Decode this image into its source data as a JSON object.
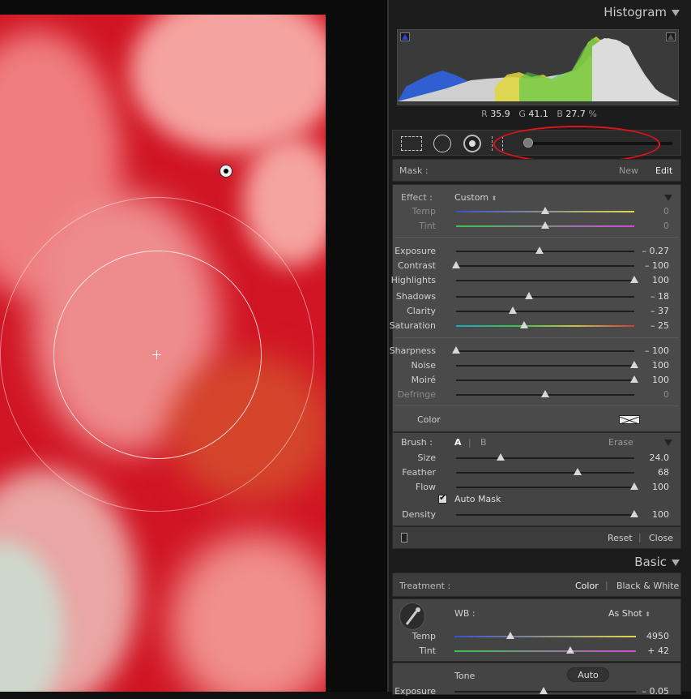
{
  "histogram": {
    "title": "Histogram",
    "readout": {
      "r_label": "R",
      "r_value": "35.9",
      "g_label": "G",
      "g_value": "41.1",
      "b_label": "B",
      "b_value": "27.7",
      "unit": "%"
    }
  },
  "toolstrip": {
    "icons": [
      "crop-overlay-icon",
      "spot-removal-icon",
      "red-eye-icon",
      "graduated-filter-icon"
    ],
    "highlight_color": "#e3121b"
  },
  "mask": {
    "label": "Mask :",
    "new_label": "New",
    "edit_label": "Edit"
  },
  "effect": {
    "label": "Effect :",
    "preset": "Custom",
    "groups": [
      [
        {
          "label": "Temp",
          "value": "0",
          "pos": 0.5,
          "track": "temp",
          "dim": true
        },
        {
          "label": "Tint",
          "value": "0",
          "pos": 0.5,
          "track": "tint",
          "dim": true
        }
      ],
      [
        {
          "label": "Exposure",
          "value": "– 0.27",
          "pos": 0.47
        },
        {
          "label": "Contrast",
          "value": "– 100",
          "pos": 0.0
        },
        {
          "label": "Highlights",
          "value": "100",
          "pos": 1.0
        },
        {
          "label": "Shadows",
          "value": "– 18",
          "pos": 0.41
        },
        {
          "label": "Clarity",
          "value": "– 37",
          "pos": 0.32
        },
        {
          "label": "Saturation",
          "value": "– 25",
          "pos": 0.38,
          "track": "sat"
        }
      ],
      [
        {
          "label": "Sharpness",
          "value": "– 100",
          "pos": 0.0
        },
        {
          "label": "Noise",
          "value": "100",
          "pos": 1.0
        },
        {
          "label": "Moiré",
          "value": "100",
          "pos": 1.0
        },
        {
          "label": "Defringe",
          "value": "0",
          "pos": 0.5,
          "dim": true
        }
      ]
    ],
    "color_label": "Color"
  },
  "brush": {
    "label": "Brush :",
    "a_label": "A",
    "b_label": "B",
    "erase_label": "Erase",
    "sliders": [
      {
        "label": "Size",
        "value": "24.0",
        "pos": 0.25
      },
      {
        "label": "Feather",
        "value": "68",
        "pos": 0.68
      },
      {
        "label": "Flow",
        "value": "100",
        "pos": 1.0
      }
    ],
    "auto_mask_label": "Auto Mask",
    "auto_mask_checked": true,
    "density": {
      "label": "Density",
      "value": "100",
      "pos": 1.0
    }
  },
  "footer": {
    "reset_label": "Reset",
    "close_label": "Close"
  },
  "basic": {
    "title": "Basic",
    "treatment_label": "Treatment :",
    "color_option": "Color",
    "bw_option": "Black & White",
    "wb_label": "WB :",
    "wb_value": "As Shot",
    "temp": {
      "label": "Temp",
      "value": "4950",
      "pos": 0.31
    },
    "tint": {
      "label": "Tint",
      "value": "+ 42",
      "pos": 0.64
    },
    "tone_label": "Tone",
    "auto_label": "Auto",
    "exposure": {
      "label": "Exposure",
      "value": "– 0.05",
      "pos": 0.49
    }
  }
}
